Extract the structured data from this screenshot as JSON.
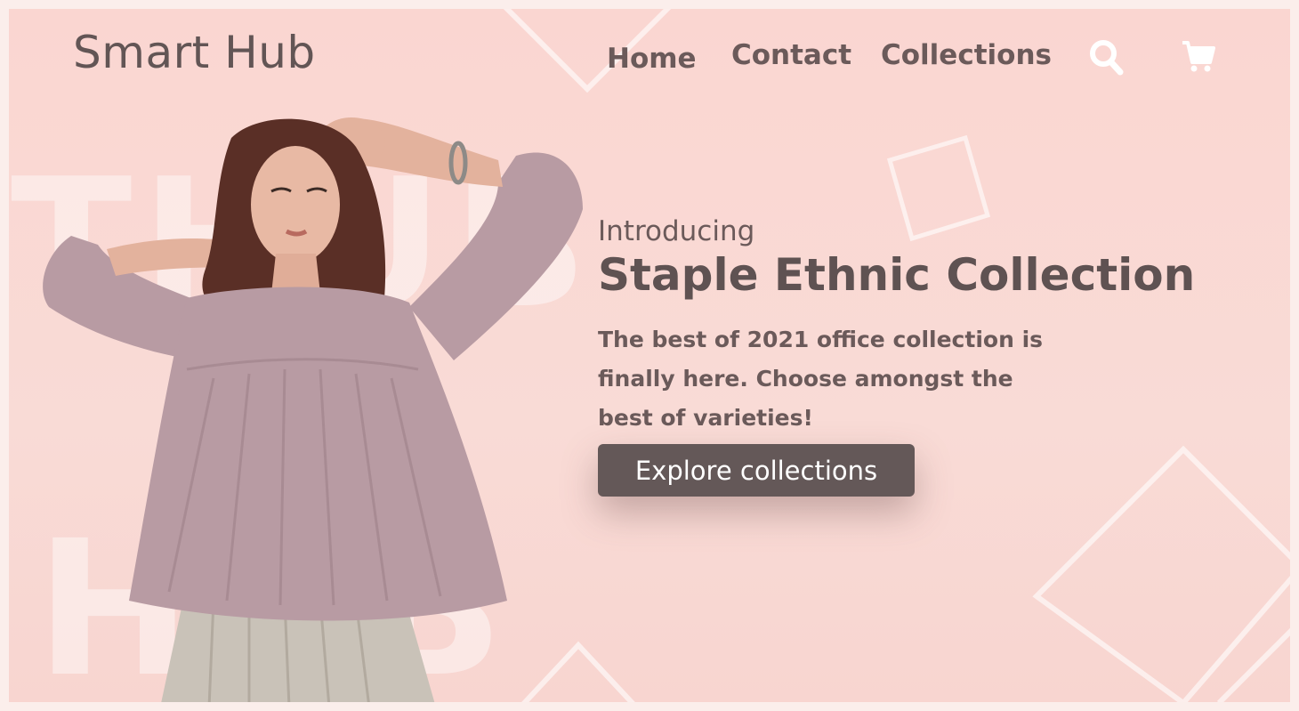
{
  "brand": {
    "name": "Smart Hub"
  },
  "nav": {
    "items": [
      {
        "label": "Home"
      },
      {
        "label": "Contact"
      },
      {
        "label": "Collections"
      }
    ],
    "search_icon": "search-icon",
    "cart_icon": "cart-icon",
    "icon_color": "#ffffff"
  },
  "background": {
    "watermark_top": "THUB",
    "watermark_bottom": "HUB",
    "colors": {
      "frame": "#fad6d1",
      "outer": "#fbeeeb"
    }
  },
  "hero": {
    "eyebrow": "Introducing",
    "title": "Staple Ethnic Collection",
    "description": "The best of 2021 office collection is finally here. Choose amongst the best of varieties!",
    "cta_label": "Explore collections",
    "cta_color": "#645858"
  }
}
